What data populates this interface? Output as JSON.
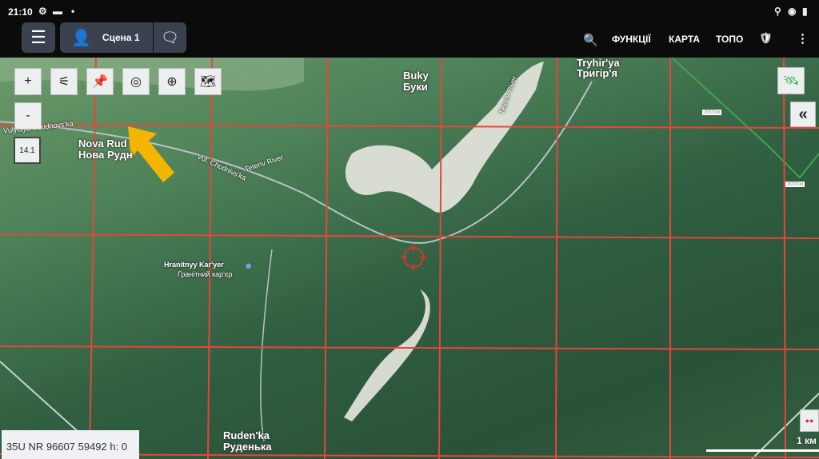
{
  "status_bar": {
    "time": "21:10",
    "icons": [
      "gear-icon",
      "image-icon",
      "dot-icon",
      "location-icon",
      "eye-icon",
      "battery-icon"
    ]
  },
  "top_bar": {
    "scene_label": "Сцена 1",
    "nav": [
      "ФУНКЦІЇ",
      "КАРТА",
      "ТОПО"
    ]
  },
  "map_tools": {
    "zoom_in": "+",
    "zoom_out": "-",
    "zoom_level": "14.1",
    "collapse": "«"
  },
  "map_labels": {
    "street1": "Vulytsya Chudnovs'ka",
    "street2": "Vul. Chudnivs'ka",
    "river": "Teteriv River",
    "river2": "Teteriv River",
    "nova_rudnia_lat": "Nova Rud",
    "nova_rudnia_cyr": "Нова Рудн",
    "buky_lat": "Buky",
    "buky_cyr": "Буки",
    "tryhirya_lat": "Tryhir'ya",
    "tryhirya_cyr": "Тригір'я",
    "quarry_lat": "Hranitnyy Kar'yer",
    "quarry_cyr": "Гранітний кар'єр",
    "rudenka_lat": "Ruden'ka",
    "rudenka_cyr": "Руденька",
    "alt1": "3000м",
    "alt2": "3000м"
  },
  "coordinates": "35U NR 96607 59492 h: 0",
  "scale": "1 км",
  "colors": {
    "grid": "#e8453c",
    "arrow": "#f5b400",
    "crosshair": "#e0302a"
  }
}
